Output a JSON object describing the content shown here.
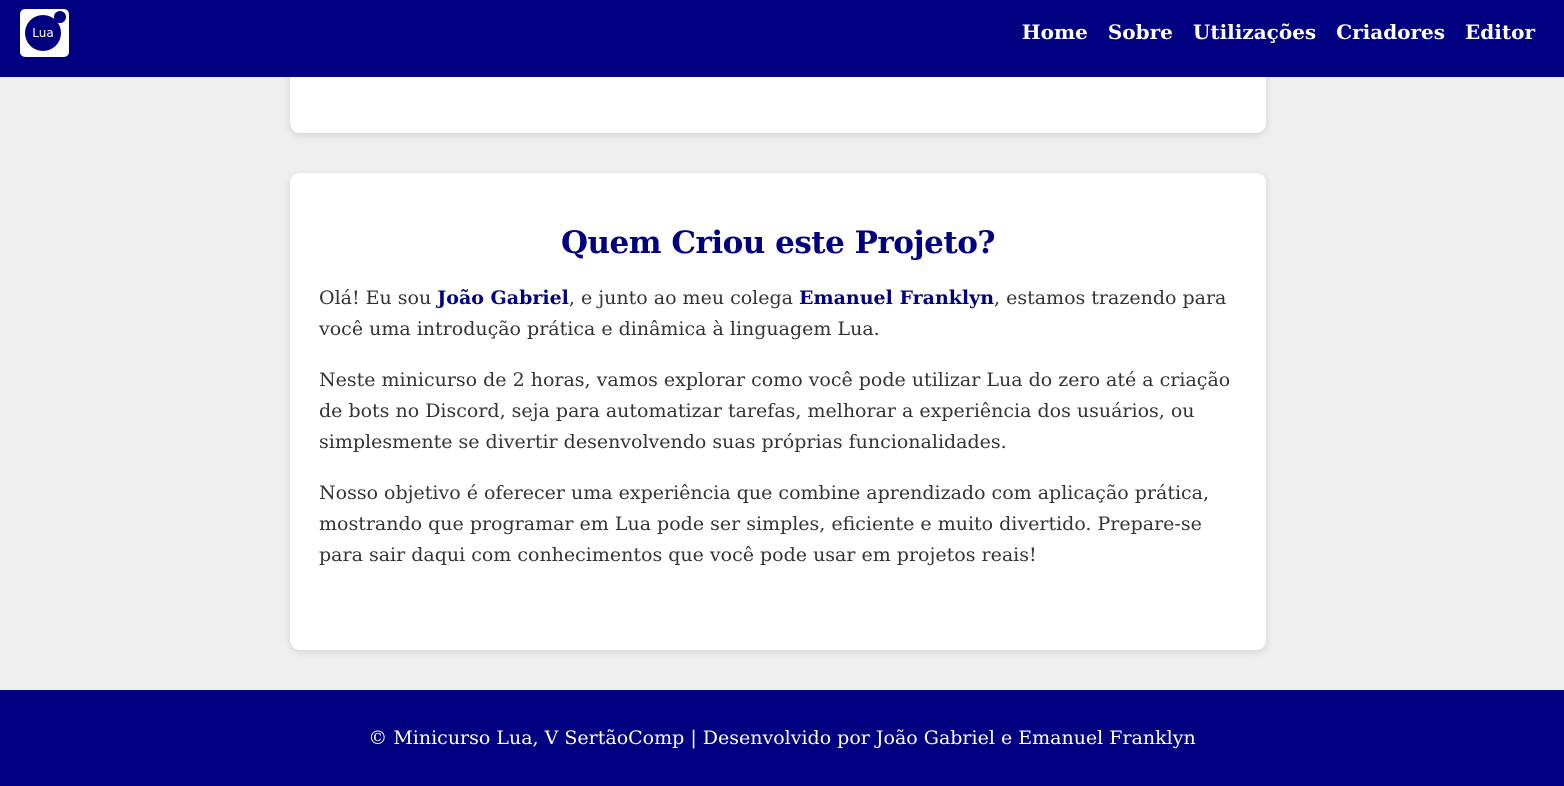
{
  "logo": {
    "text": "Lua"
  },
  "nav": {
    "links": [
      "Home",
      "Sobre",
      "Utilizações",
      "Criadores",
      "Editor"
    ]
  },
  "section": {
    "title": "Quem Criou este Projeto?",
    "p1_intro": "Olá! Eu sou ",
    "author1": "João Gabriel",
    "p1_mid": ", e junto ao meu colega ",
    "author2": "Emanuel Franklyn",
    "p1_end": ", estamos trazendo para você uma introdução prática e dinâmica à linguagem Lua.",
    "p2": "Neste minicurso de 2 horas, vamos explorar como você pode utilizar Lua do zero até a criação de bots no Discord, seja para automatizar tarefas, melhorar a experiência dos usuários, ou simplesmente se divertir desenvolvendo suas próprias funcionalidades.",
    "p3": "Nosso objetivo é oferecer uma experiência que combine aprendizado com aplicação prática, mostrando que programar em Lua pode ser simples, eficiente e muito divertido. Prepare-se para sair daqui com conhecimentos que você pode usar em projetos reais!"
  },
  "footer": {
    "text": "© Minicurso Lua, V SertãoComp | Desenvolvido por João Gabriel e Emanuel Franklyn"
  },
  "colors": {
    "primary": "#000080",
    "background": "#efefef",
    "card": "#ffffff",
    "text": "#333333"
  }
}
